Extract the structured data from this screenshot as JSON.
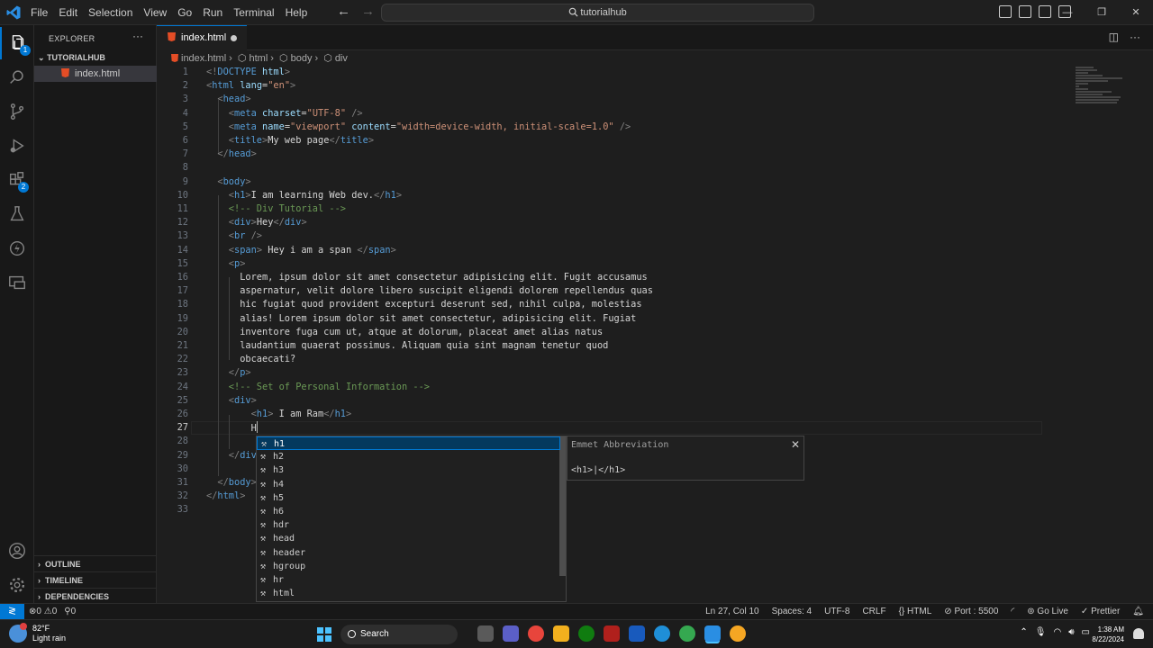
{
  "titlebar": {
    "menu": [
      "File",
      "Edit",
      "Selection",
      "View",
      "Go",
      "Run",
      "Terminal",
      "Help"
    ],
    "search": "tutorialhub"
  },
  "sidebar": {
    "title": "EXPLORER",
    "folder": "TUTORIALHUB",
    "file": "index.html",
    "sections": [
      "OUTLINE",
      "TIMELINE",
      "DEPENDENCIES"
    ],
    "badges": {
      "explorer": "1",
      "extensions": "2"
    }
  },
  "tab": {
    "label": "index.html"
  },
  "breadcrumb": [
    "index.html",
    "html",
    "body",
    "div"
  ],
  "code": [
    {
      "n": "1",
      "h": "<span class=\"b\">&lt;!</span><span class=\"t\">DOCTYPE</span> <span class=\"a\">html</span><span class=\"b\">&gt;</span>",
      "i": 0
    },
    {
      "n": "2",
      "h": "<span class=\"b\">&lt;</span><span class=\"t\">html</span> <span class=\"a\">lang</span><span class=\"w\">=</span><span class=\"s\">\"en\"</span><span class=\"b\">&gt;</span>",
      "i": 0
    },
    {
      "n": "3",
      "h": "<span class=\"b\">&lt;</span><span class=\"t\">head</span><span class=\"b\">&gt;</span>",
      "i": 1
    },
    {
      "n": "4",
      "h": "<span class=\"b\">&lt;</span><span class=\"t\">meta</span> <span class=\"a\">charset</span><span class=\"w\">=</span><span class=\"s\">\"UTF-8\"</span> <span class=\"b\">/&gt;</span>",
      "i": 2
    },
    {
      "n": "5",
      "h": "<span class=\"b\">&lt;</span><span class=\"t\">meta</span> <span class=\"a\">name</span><span class=\"w\">=</span><span class=\"s\">\"viewport\"</span> <span class=\"a\">content</span><span class=\"w\">=</span><span class=\"s\">\"width=device-width, initial-scale=1.0\"</span> <span class=\"b\">/&gt;</span>",
      "i": 2
    },
    {
      "n": "6",
      "h": "<span class=\"b\">&lt;</span><span class=\"t\">title</span><span class=\"b\">&gt;</span><span class=\"w\">My web page</span><span class=\"b\">&lt;/</span><span class=\"t\">title</span><span class=\"b\">&gt;</span>",
      "i": 2
    },
    {
      "n": "7",
      "h": "<span class=\"b\">&lt;/</span><span class=\"t\">head</span><span class=\"b\">&gt;</span>",
      "i": 1
    },
    {
      "n": "8",
      "h": "",
      "i": 0
    },
    {
      "n": "9",
      "h": "<span class=\"b\">&lt;</span><span class=\"t\">body</span><span class=\"b\">&gt;</span>",
      "i": 1
    },
    {
      "n": "10",
      "h": "<span class=\"b\">&lt;</span><span class=\"t\">h1</span><span class=\"b\">&gt;</span><span class=\"w\">I am learning Web dev.</span><span class=\"b\">&lt;/</span><span class=\"t\">h1</span><span class=\"b\">&gt;</span>",
      "i": 2
    },
    {
      "n": "11",
      "h": "<span class=\"c\">&lt;!-- Div Tutorial --&gt;</span>",
      "i": 2
    },
    {
      "n": "12",
      "h": "<span class=\"b\">&lt;</span><span class=\"t\">div</span><span class=\"b\">&gt;</span><span class=\"w\">Hey</span><span class=\"b\">&lt;/</span><span class=\"t\">div</span><span class=\"b\">&gt;</span>",
      "i": 2
    },
    {
      "n": "13",
      "h": "<span class=\"b\">&lt;</span><span class=\"t\">br</span> <span class=\"b\">/&gt;</span>",
      "i": 2
    },
    {
      "n": "14",
      "h": "<span class=\"b\">&lt;</span><span class=\"t\">span</span><span class=\"b\">&gt;</span><span class=\"w\"> Hey i am a span </span><span class=\"b\">&lt;/</span><span class=\"t\">span</span><span class=\"b\">&gt;</span>",
      "i": 2
    },
    {
      "n": "15",
      "h": "<span class=\"b\">&lt;</span><span class=\"t\">p</span><span class=\"b\">&gt;</span>",
      "i": 2
    },
    {
      "n": "16",
      "h": "<span class=\"w\">Lorem, ipsum dolor sit amet consectetur adipisicing elit. Fugit accusamus</span>",
      "i": 3
    },
    {
      "n": "17",
      "h": "<span class=\"w\">aspernatur, velit dolore libero suscipit eligendi dolorem repellendus quas</span>",
      "i": 3
    },
    {
      "n": "18",
      "h": "<span class=\"w\">hic fugiat quod provident excepturi deserunt sed, nihil culpa, molestias</span>",
      "i": 3
    },
    {
      "n": "19",
      "h": "<span class=\"w\">alias! Lorem ipsum dolor sit amet consectetur, adipisicing elit. Fugiat</span>",
      "i": 3
    },
    {
      "n": "20",
      "h": "<span class=\"w\">inventore fuga cum ut, atque at dolorum, placeat amet alias natus</span>",
      "i": 3
    },
    {
      "n": "21",
      "h": "<span class=\"w\">laudantium quaerat possimus. Aliquam quia sint magnam tenetur quod</span>",
      "i": 3
    },
    {
      "n": "22",
      "h": "<span class=\"w\">obcaecati?</span>",
      "i": 3
    },
    {
      "n": "23",
      "h": "<span class=\"b\">&lt;/</span><span class=\"t\">p</span><span class=\"b\">&gt;</span>",
      "i": 2
    },
    {
      "n": "24",
      "h": "<span class=\"c\">&lt;!-- Set of Personal Information --&gt;</span>",
      "i": 2
    },
    {
      "n": "25",
      "h": "<span class=\"b\">&lt;</span><span class=\"t\">div</span><span class=\"b\">&gt;</span>",
      "i": 2
    },
    {
      "n": "26",
      "h": "<span class=\"b\">&lt;</span><span class=\"t\">h1</span><span class=\"b\">&gt;</span><span class=\"w\"> I am Ram</span><span class=\"b\">&lt;/</span><span class=\"t\">h1</span><span class=\"b\">&gt;</span>",
      "i": 4
    },
    {
      "n": "27",
      "h": "<span class=\"w\">H</span><span class=\"caret\"></span>",
      "i": 4
    },
    {
      "n": "28",
      "h": "",
      "i": 0
    },
    {
      "n": "29",
      "h": "<span class=\"b\">&lt;/</span><span class=\"t\">div</span><span class=\"b\">&gt;</span>",
      "i": 2
    },
    {
      "n": "30",
      "h": "",
      "i": 0
    },
    {
      "n": "31",
      "h": "<span class=\"b\">&lt;/</span><span class=\"t\">body</span><span class=\"b\">&gt;</span>",
      "i": 1
    },
    {
      "n": "32",
      "h": "<span class=\"b\">&lt;/</span><span class=\"t\">html</span><span class=\"b\">&gt;</span>",
      "i": 0
    },
    {
      "n": "33",
      "h": "",
      "i": 0
    }
  ],
  "suggest": [
    "h1",
    "h2",
    "h3",
    "h4",
    "h5",
    "h6",
    "hdr",
    "head",
    "header",
    "hgroup",
    "hr",
    "html"
  ],
  "detail": {
    "title": "Emmet Abbreviation",
    "body": "<h1>|</h1>"
  },
  "status": {
    "errors": "0",
    "warnings": "0",
    "ports": "0",
    "position": "Ln 27, Col 10",
    "spaces": "Spaces: 4",
    "encoding": "UTF-8",
    "eol": "CRLF",
    "lang": "HTML",
    "port": "Port : 5500",
    "golive": "Go Live",
    "prettier": "Prettier"
  },
  "taskbar": {
    "temp": "82°F",
    "weather": "Light rain",
    "search": "Search",
    "time": "1:38 AM",
    "date": "8/22/2024"
  },
  "colors": {
    "accent": "#0078d4",
    "tag": "#569cd6",
    "attr": "#9cdcfe",
    "string": "#ce9178",
    "comment": "#6a9955"
  }
}
